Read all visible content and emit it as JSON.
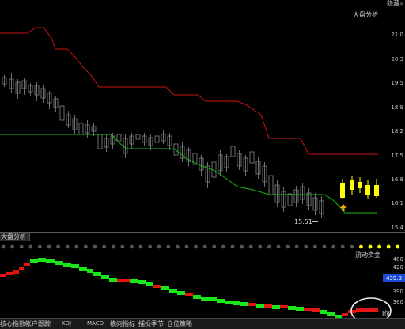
{
  "top_right": {
    "label": "隐藏",
    "icon": "double-chevron-right-icon"
  },
  "main_panel": {
    "title": "大盘分析",
    "y_ticks": [
      "21.0",
      "20.3",
      "19.5",
      "18.9",
      "18.2",
      "17.5",
      "16.8",
      "16.1",
      "15.4"
    ],
    "low_marker": "15.51",
    "colors": {
      "resistance": "#c81414",
      "support": "#16b816",
      "candle_up": "#ffff00",
      "candle_hist": "#6e6e6e",
      "marker": "#ffaa00"
    }
  },
  "sub_panel": {
    "title": "大盘分析",
    "indicator_label": "流动资金",
    "y_ticks": [
      "480",
      "420",
      "390",
      "360"
    ],
    "current_value": "439.3",
    "corner_label": "I位",
    "colors": {
      "up": "#19e619",
      "down": "#e61414",
      "dot_on": "#ffff00",
      "dot_off": "#555555",
      "value_box": "#1d4bd8"
    },
    "highlight_dots": 5
  },
  "tabs": [
    "核心指数",
    "帐户跟踪",
    "KDJ",
    "MACD",
    "横向指标",
    "捕捉季节",
    "仓位策略"
  ]
}
